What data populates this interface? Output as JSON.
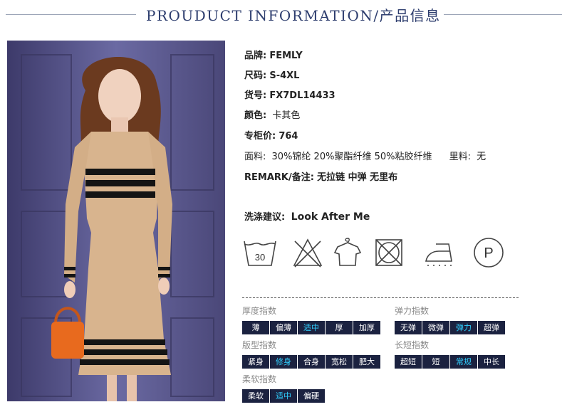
{
  "header": {
    "title": "PROUDUCT INFORMATION/产品信息"
  },
  "product": {
    "brand_label": "品牌:",
    "brand_value": "FEMLY",
    "size_label": "尺码:",
    "size_value": "S-4XL",
    "sku_label": "货号:",
    "sku_value": "FX7DL14433",
    "color_label": "颜色:",
    "color_value": "卡其色",
    "price_label": "专柜价:",
    "price_value": "764",
    "fabric_label": "面料:",
    "fabric_value": "30%锦纶 20%聚酯纤维 50%粘胶纤维",
    "lining_label": "里料:",
    "lining_value": "无",
    "remark_label": "REMARK/备注:",
    "remark_value": "无拉链 中弹 无里布",
    "wash_label": "洗涤建议:",
    "wash_value": "Look After Me"
  },
  "care_icons": {
    "wash_temp": "30",
    "dry_clean": "P"
  },
  "indices": {
    "thickness": {
      "label": "厚度指数",
      "options": [
        "薄",
        "偏薄",
        "适中",
        "厚",
        "加厚"
      ],
      "selected": 2
    },
    "elasticity": {
      "label": "弹力指数",
      "options": [
        "无弹",
        "微弹",
        "弹力",
        "超弹"
      ],
      "selected": 2
    },
    "fit": {
      "label": "版型指数",
      "options": [
        "紧身",
        "修身",
        "合身",
        "宽松",
        "肥大"
      ],
      "selected": 1
    },
    "length": {
      "label": "长短指数",
      "options": [
        "超短",
        "短",
        "常规",
        "中长"
      ],
      "selected": 2
    },
    "softness": {
      "label": "柔软指数",
      "options": [
        "柔软",
        "适中",
        "偏硬"
      ],
      "selected": 1
    }
  },
  "colors": {
    "chip_bg": "#1b2240",
    "chip_selected_text": "#30d0ff",
    "title": "#2d3d6e",
    "dress": "#d8b48e",
    "bag": "#e86a1e"
  }
}
